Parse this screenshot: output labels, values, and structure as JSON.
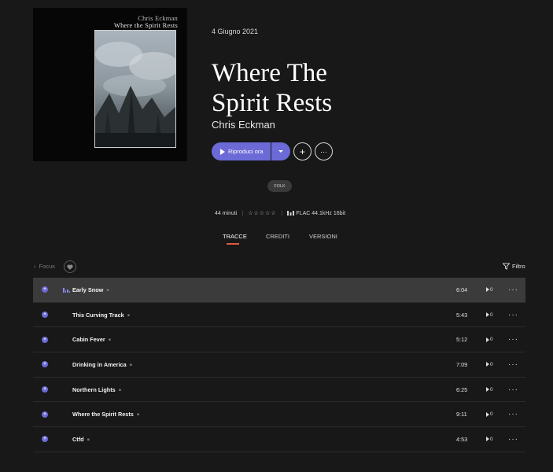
{
  "album": {
    "cover_artist": "Chris Eckman",
    "cover_title": "Where the Spirit Rests",
    "date": "4 Giugno 2021",
    "title_line1": "Where The",
    "title_line2": "Spirit Rests",
    "artist": "Chris Eckman",
    "genre": "FOLK",
    "duration": "44 minuti",
    "rating_stars": "☆☆☆☆☆",
    "quality": "FLAC 44.1kHz 16bit"
  },
  "actions": {
    "play_label": "Riproduci ora",
    "add_symbol": "+",
    "more_symbol": "···"
  },
  "tabs": [
    {
      "label": "TRACCE",
      "active": true
    },
    {
      "label": "CREDITI",
      "active": false
    },
    {
      "label": "VERSIONI",
      "active": false
    }
  ],
  "toolbar": {
    "focus_label": "Focus",
    "filter_label": "Filtro"
  },
  "tracks": [
    {
      "title": "Early Snow",
      "duration": "6:04",
      "plays": "0",
      "playing": true
    },
    {
      "title": "This Curving Track",
      "duration": "5:43",
      "plays": "0",
      "playing": false
    },
    {
      "title": "Cabin Fever",
      "duration": "5:12",
      "plays": "0",
      "playing": false
    },
    {
      "title": "Drinking in America",
      "duration": "7:09",
      "plays": "0",
      "playing": false
    },
    {
      "title": "Northern Lights",
      "duration": "6:25",
      "plays": "0",
      "playing": false
    },
    {
      "title": "Where the Spirit Rests",
      "duration": "9:11",
      "plays": "0",
      "playing": false
    },
    {
      "title": "Ctfd",
      "duration": "4:53",
      "plays": "0",
      "playing": false
    }
  ],
  "colors": {
    "accent": "#6b6ad6",
    "tab_underline": "#e3593d",
    "background": "#181818"
  }
}
